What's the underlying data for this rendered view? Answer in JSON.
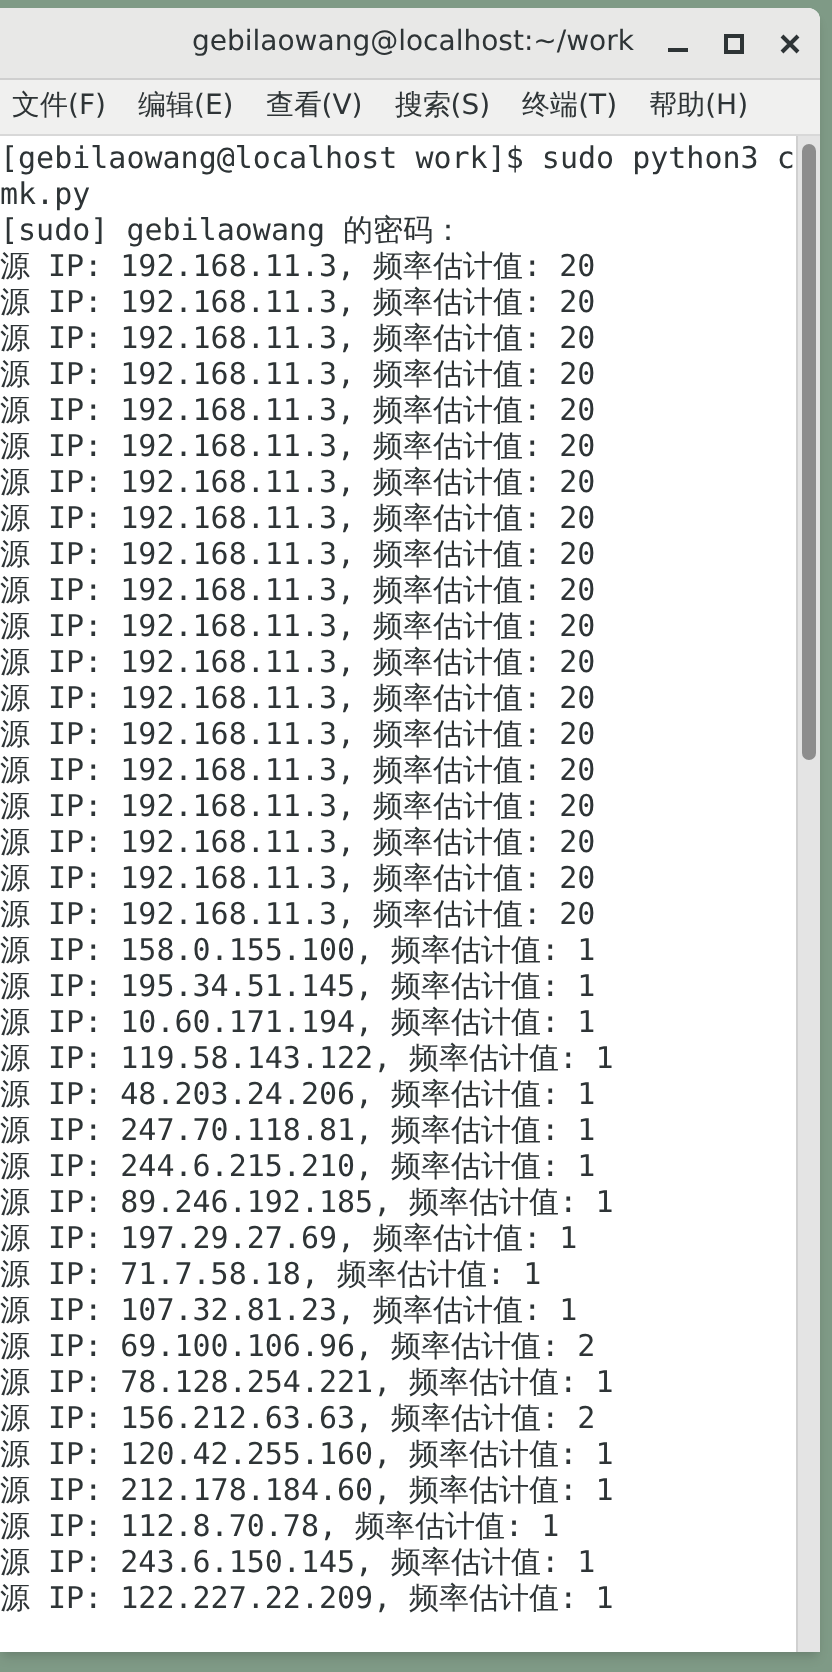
{
  "window": {
    "title": "gebilaowang@localhost:~/work"
  },
  "menu": [
    {
      "label": "文件(F)"
    },
    {
      "label": "编辑(E)"
    },
    {
      "label": "查看(V)"
    },
    {
      "label": "搜索(S)"
    },
    {
      "label": "终端(T)"
    },
    {
      "label": "帮助(H)"
    }
  ],
  "terminal": {
    "lines": [
      "[gebilaowang@localhost work]$ sudo python3 c",
      "mk.py",
      "[sudo] gebilaowang 的密码：",
      "源 IP: 192.168.11.3, 频率估计值: 20",
      "源 IP: 192.168.11.3, 频率估计值: 20",
      "源 IP: 192.168.11.3, 频率估计值: 20",
      "源 IP: 192.168.11.3, 频率估计值: 20",
      "源 IP: 192.168.11.3, 频率估计值: 20",
      "源 IP: 192.168.11.3, 频率估计值: 20",
      "源 IP: 192.168.11.3, 频率估计值: 20",
      "源 IP: 192.168.11.3, 频率估计值: 20",
      "源 IP: 192.168.11.3, 频率估计值: 20",
      "源 IP: 192.168.11.3, 频率估计值: 20",
      "源 IP: 192.168.11.3, 频率估计值: 20",
      "源 IP: 192.168.11.3, 频率估计值: 20",
      "源 IP: 192.168.11.3, 频率估计值: 20",
      "源 IP: 192.168.11.3, 频率估计值: 20",
      "源 IP: 192.168.11.3, 频率估计值: 20",
      "源 IP: 192.168.11.3, 频率估计值: 20",
      "源 IP: 192.168.11.3, 频率估计值: 20",
      "源 IP: 192.168.11.3, 频率估计值: 20",
      "源 IP: 192.168.11.3, 频率估计值: 20",
      "源 IP: 158.0.155.100, 频率估计值: 1",
      "源 IP: 195.34.51.145, 频率估计值: 1",
      "源 IP: 10.60.171.194, 频率估计值: 1",
      "源 IP: 119.58.143.122, 频率估计值: 1",
      "源 IP: 48.203.24.206, 频率估计值: 1",
      "源 IP: 247.70.118.81, 频率估计值: 1",
      "源 IP: 244.6.215.210, 频率估计值: 1",
      "源 IP: 89.246.192.185, 频率估计值: 1",
      "源 IP: 197.29.27.69, 频率估计值: 1",
      "源 IP: 71.7.58.18, 频率估计值: 1",
      "源 IP: 107.32.81.23, 频率估计值: 1",
      "源 IP: 69.100.106.96, 频率估计值: 2",
      "源 IP: 78.128.254.221, 频率估计值: 1",
      "源 IP: 156.212.63.63, 频率估计值: 2",
      "源 IP: 120.42.255.160, 频率估计值: 1",
      "源 IP: 212.178.184.60, 频率估计值: 1",
      "源 IP: 112.8.70.78, 频率估计值: 1",
      "源 IP: 243.6.150.145, 频率估计值: 1",
      "源 IP: 122.227.22.209, 频率估计值: 1"
    ]
  }
}
